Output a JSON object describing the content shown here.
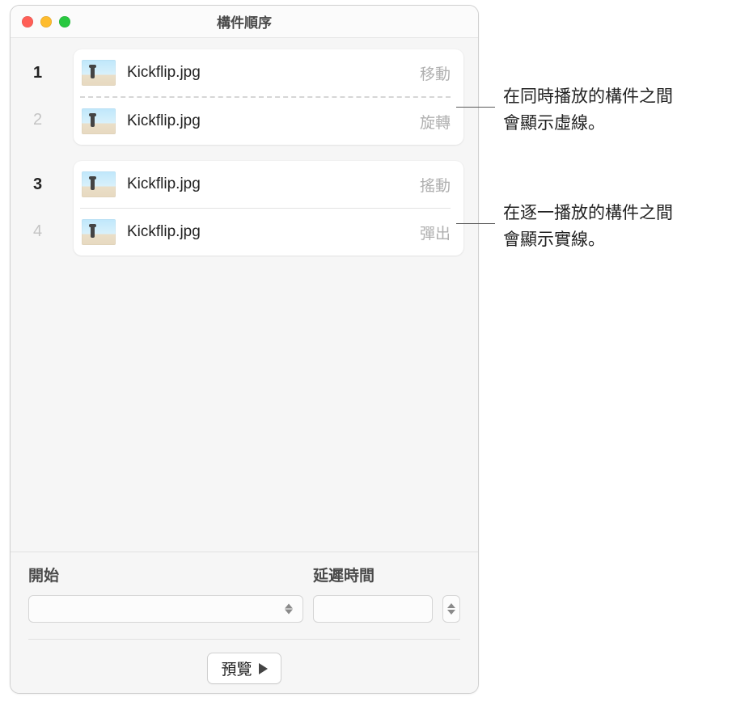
{
  "window": {
    "title": "構件順序"
  },
  "list": {
    "groups": [
      {
        "rows": [
          {
            "index": "1",
            "indexDim": false,
            "filename": "Kickflip.jpg",
            "effect": "移動"
          },
          {
            "index": "2",
            "indexDim": true,
            "filename": "Kickflip.jpg",
            "effect": "旋轉"
          }
        ],
        "dividerStyle": "dashed"
      },
      {
        "rows": [
          {
            "index": "3",
            "indexDim": false,
            "filename": "Kickflip.jpg",
            "effect": "搖動"
          },
          {
            "index": "4",
            "indexDim": true,
            "filename": "Kickflip.jpg",
            "effect": "彈出"
          }
        ],
        "dividerStyle": "solid"
      }
    ]
  },
  "controls": {
    "start_label": "開始",
    "delay_label": "延遲時間",
    "start_value": "",
    "delay_value": ""
  },
  "preview": {
    "label": "預覽"
  },
  "callouts": {
    "c1_line1": "在同時播放的構件之間",
    "c1_line2": "會顯示虛線。",
    "c2_line1": "在逐一播放的構件之間",
    "c2_line2": "會顯示實線。"
  }
}
